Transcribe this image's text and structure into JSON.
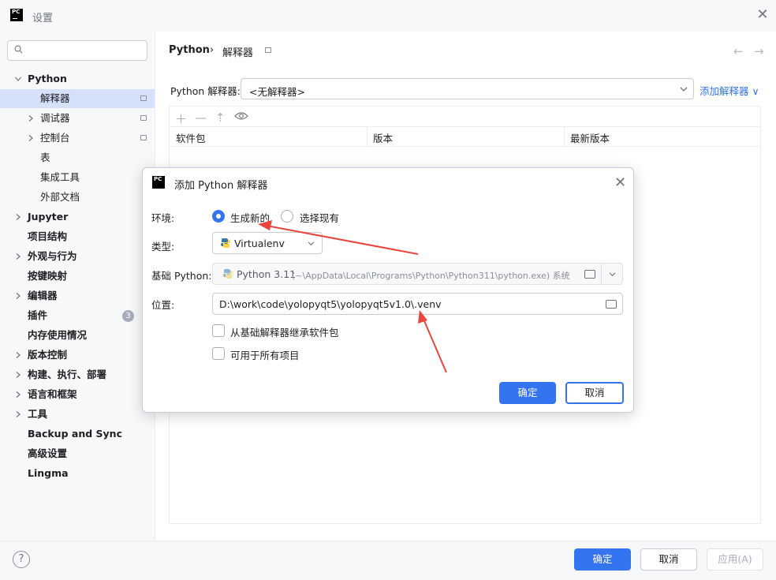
{
  "window": {
    "title": "设置",
    "logo_text": "PC"
  },
  "sidebar": {
    "search_placeholder": "",
    "items": [
      {
        "label": "Python",
        "bold": true,
        "expanded": true,
        "level": 0
      },
      {
        "label": "解释器",
        "selected": true,
        "level": 1,
        "pinned": true
      },
      {
        "label": "调试器",
        "level": 1,
        "chevron": true,
        "pinned": true
      },
      {
        "label": "控制台",
        "level": 1,
        "chevron": true,
        "pinned": true
      },
      {
        "label": "表",
        "level": 1
      },
      {
        "label": "集成工具",
        "level": 1
      },
      {
        "label": "外部文档",
        "level": 1
      },
      {
        "label": "Jupyter",
        "bold": true,
        "chevron": true,
        "level": 0
      },
      {
        "label": "项目结构",
        "bold": true,
        "level": 0
      },
      {
        "label": "外观与行为",
        "bold": true,
        "chevron": true,
        "level": 0
      },
      {
        "label": "按键映射",
        "bold": true,
        "level": 0
      },
      {
        "label": "编辑器",
        "bold": true,
        "chevron": true,
        "level": 0
      },
      {
        "label": "插件",
        "bold": true,
        "level": 0,
        "badge": "3"
      },
      {
        "label": "内存使用情况",
        "bold": true,
        "level": 0
      },
      {
        "label": "版本控制",
        "bold": true,
        "chevron": true,
        "level": 0
      },
      {
        "label": "构建、执行、部署",
        "bold": true,
        "chevron": true,
        "level": 0
      },
      {
        "label": "语言和框架",
        "bold": true,
        "chevron": true,
        "level": 0
      },
      {
        "label": "工具",
        "bold": true,
        "chevron": true,
        "level": 0
      },
      {
        "label": "Backup and Sync",
        "bold": true,
        "level": 0
      },
      {
        "label": "高级设置",
        "bold": true,
        "level": 0
      },
      {
        "label": "Lingma",
        "bold": true,
        "level": 0
      }
    ]
  },
  "main": {
    "breadcrumb": {
      "parent": "Python",
      "separator": "›",
      "current": "解释器"
    },
    "interpreter_label": "Python 解释器:",
    "interpreter_value": "<无解释器>",
    "add_interpreter": "添加解释器 ∨",
    "table": {
      "columns": [
        "软件包",
        "版本",
        "最新版本"
      ],
      "toolbar": [
        "add-icon",
        "remove-icon",
        "upgrade-icon",
        "eye-icon"
      ]
    }
  },
  "footer": {
    "help": "?",
    "ok": "确定",
    "cancel": "取消",
    "apply": "应用(A)"
  },
  "dialog": {
    "title": "添加 Python 解释器",
    "env_label": "环境:",
    "env_new": "生成新的",
    "env_existing": "选择现有",
    "type_label": "类型:",
    "type_value": "Virtualenv",
    "base_label": "基础 Python:",
    "base_version": "Python 3.11",
    "base_path": "(~\\AppData\\Local\\Programs\\Python\\Python311\\python.exe) 系统",
    "location_label": "位置:",
    "location_value": "D:\\work\\code\\yolopyqt5\\yolopyqt5v1.0\\.venv",
    "inherit_label": "从基础解释器继承软件包",
    "all_projects_label": "可用于所有项目",
    "ok": "确定",
    "cancel": "取消"
  },
  "colors": {
    "accent": "#3574f0",
    "annotation_arrow": "#e8453c",
    "selection": "#d5e1fb"
  }
}
